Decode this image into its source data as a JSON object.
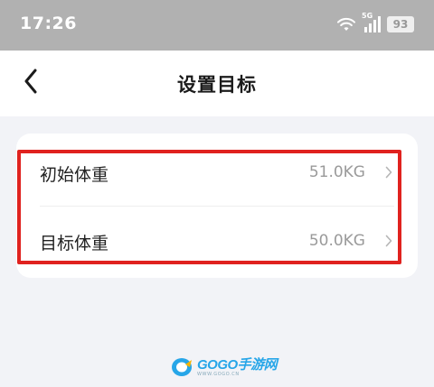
{
  "status_bar": {
    "time": "17:26",
    "signal_label": "5G",
    "battery": "93"
  },
  "header": {
    "title": "设置目标"
  },
  "settings": {
    "rows": [
      {
        "label": "初始体重",
        "value": "51.0KG"
      },
      {
        "label": "目标体重",
        "value": "50.0KG"
      }
    ]
  },
  "watermark": {
    "brand": "GOGO手游网",
    "url": "WWW.GOGO.CN"
  },
  "icons": {
    "back": "chevron-left-icon",
    "row_arrow": "chevron-right-icon",
    "wifi": "wifi-icon",
    "signal": "signal-icon",
    "battery": "battery-icon"
  },
  "colors": {
    "status_bar_bg": "#b1b1b1",
    "page_bg": "#f2f3f7",
    "card_bg": "#ffffff",
    "highlight_border": "#e0221f",
    "value_text": "#9a9a9a"
  }
}
